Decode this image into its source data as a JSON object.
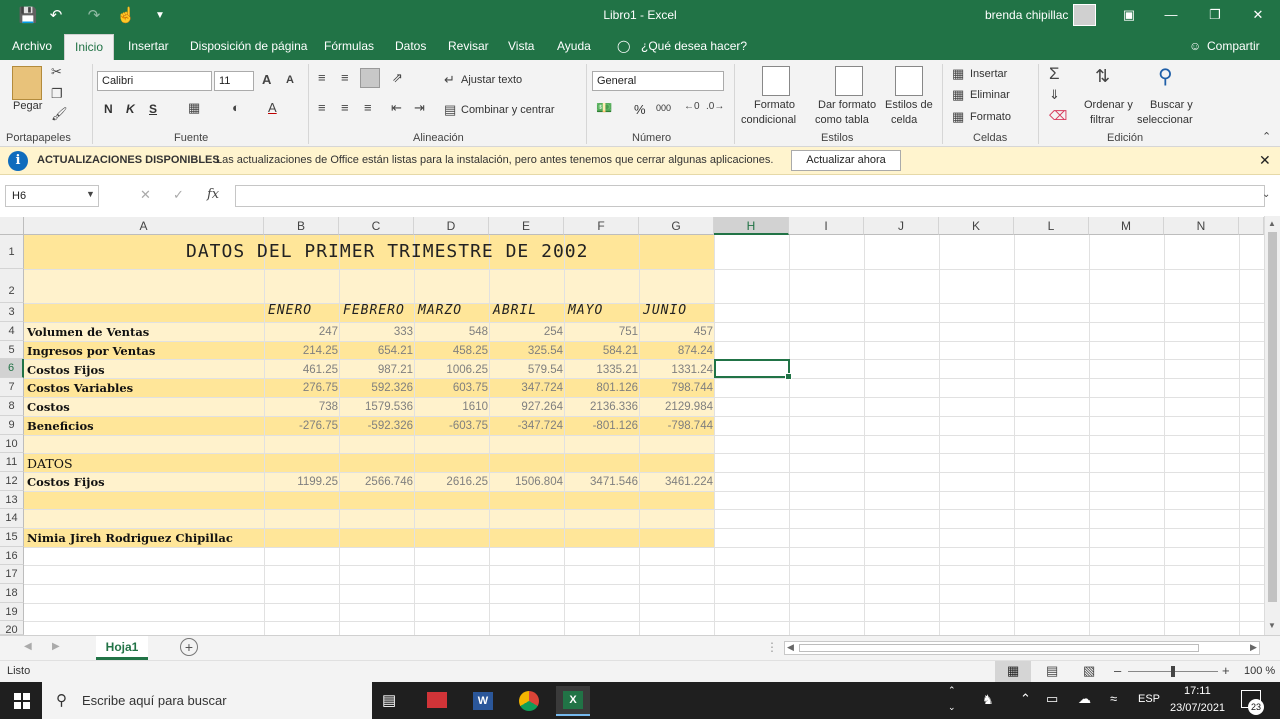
{
  "title_bar": {
    "title": "Libro1  -  Excel",
    "user": "brenda chipillac"
  },
  "menu": {
    "tabs": [
      "Archivo",
      "Inicio",
      "Insertar",
      "Disposición de página",
      "Fórmulas",
      "Datos",
      "Revisar",
      "Vista",
      "Ayuda"
    ],
    "tell_me": "¿Qué desea hacer?",
    "share": "Compartir"
  },
  "ribbon": {
    "paste": "Pegar",
    "font_name": "Calibri",
    "font_size": "11",
    "bold": "N",
    "italic": "K",
    "underline": "S",
    "wrap_text": "Ajustar texto",
    "merge_center": "Combinar y centrar",
    "number_format": "General",
    "percent": "%",
    "thousands": "000",
    "cond_format_1": "Formato",
    "cond_format_2": "condicional",
    "format_table_1": "Dar formato",
    "format_table_2": "como tabla",
    "cell_styles_1": "Estilos de",
    "cell_styles_2": "celda",
    "insert": "Insertar",
    "delete": "Eliminar",
    "format": "Formato",
    "sort_1": "Ordenar y",
    "sort_2": "filtrar",
    "find_1": "Buscar y",
    "find_2": "seleccionar",
    "groups": [
      "Portapapeles",
      "Fuente",
      "Alineación",
      "Número",
      "Estilos",
      "Celdas",
      "Edición"
    ]
  },
  "notification": {
    "title": "ACTUALIZACIONES DISPONIBLES",
    "message": "Las actualizaciones de Office están listas para la instalación, pero antes tenemos que cerrar algunas aplicaciones.",
    "button": "Actualizar ahora"
  },
  "formula_bar": {
    "name_box": "H6",
    "fx": "fx",
    "value": ""
  },
  "columns": [
    "A",
    "B",
    "C",
    "D",
    "E",
    "F",
    "G",
    "H",
    "I",
    "J",
    "K",
    "L",
    "M",
    "N"
  ],
  "rows": [
    "1",
    "2",
    "3",
    "4",
    "5",
    "6",
    "7",
    "8",
    "9",
    "10",
    "11",
    "12",
    "13",
    "14",
    "15",
    "16",
    "17",
    "18",
    "19",
    "20"
  ],
  "sheet": {
    "title": "DATOS DEL PRIMER TRIMESTRE DE 2002",
    "months": [
      "ENERO",
      "FEBRERO",
      "MARZO",
      "ABRIL",
      "MAYO",
      "JUNIO"
    ],
    "data_rows": [
      {
        "label": "Volumen de Ventas",
        "values": [
          "247",
          "333",
          "548",
          "254",
          "751",
          "457"
        ]
      },
      {
        "label": "Ingresos por Ventas",
        "values": [
          "214.25",
          "654.21",
          "458.25",
          "325.54",
          "584.21",
          "874.24"
        ]
      },
      {
        "label": "Costos Fijos",
        "values": [
          "461.25",
          "987.21",
          "1006.25",
          "579.54",
          "1335.21",
          "1331.24"
        ]
      },
      {
        "label": "Costos Variables",
        "values": [
          "276.75",
          "592.326",
          "603.75",
          "347.724",
          "801.126",
          "798.744"
        ]
      },
      {
        "label": "Costos",
        "values": [
          "738",
          "1579.536",
          "1610",
          "927.264",
          "2136.336",
          "2129.984"
        ]
      },
      {
        "label": "Beneficios",
        "values": [
          "-276.75",
          "-592.326",
          "-603.75",
          "-347.724",
          "-801.126",
          "-798.744"
        ]
      }
    ],
    "datos_label": "DATOS",
    "datos_row": {
      "label": "Costos Fijos",
      "values": [
        "1199.25",
        "2566.746",
        "2616.25",
        "1506.804",
        "3471.546",
        "3461.224"
      ]
    },
    "author": "Nimia Jireh Rodriguez Chipillac"
  },
  "sheet_tabs": {
    "active": "Hoja1"
  },
  "status": {
    "mode": "Listo",
    "zoom": "100 %"
  },
  "taskbar": {
    "search": "Escribe aquí para buscar",
    "language": "ESP",
    "time": "17:11",
    "date": "23/07/2021",
    "notif_count": "23"
  },
  "colors": {
    "excel_green": "#217346",
    "band_dark": "#ffe699",
    "band_light": "#fff2cc"
  }
}
